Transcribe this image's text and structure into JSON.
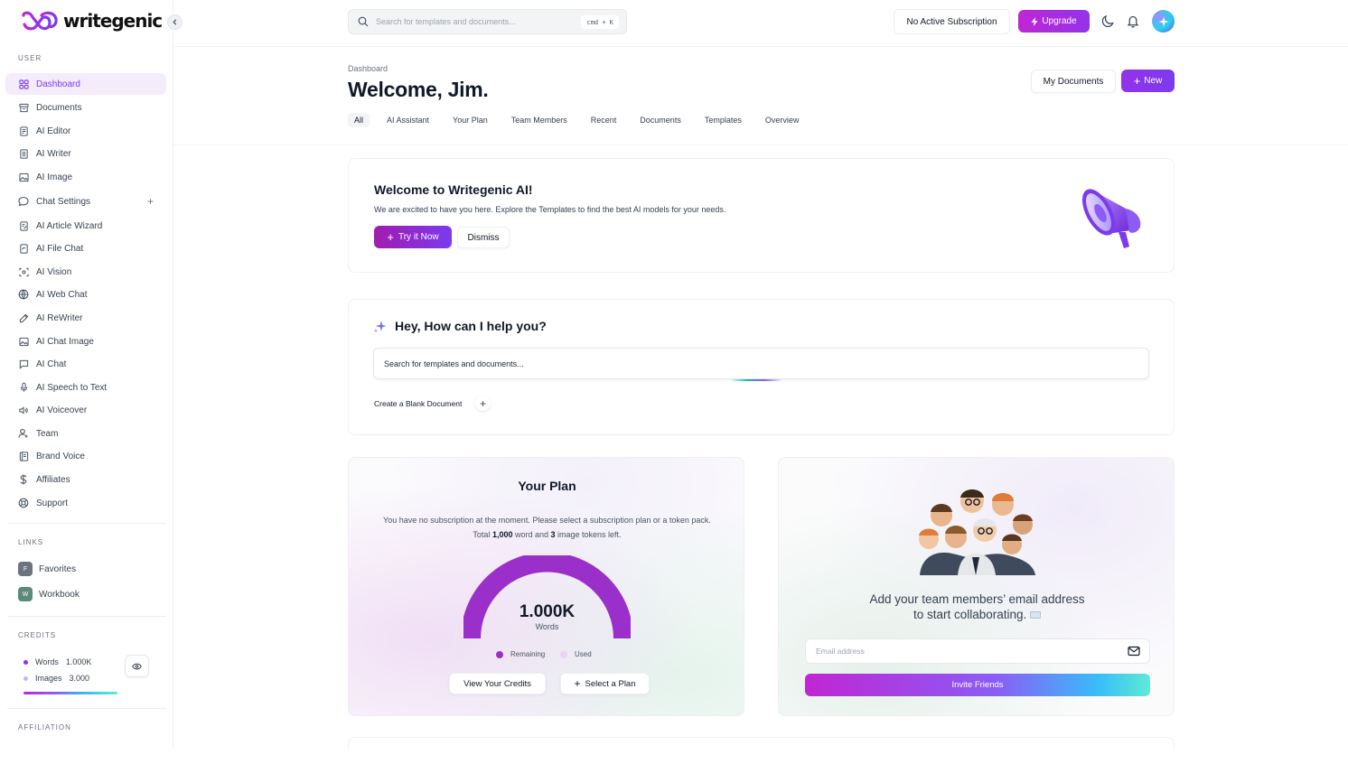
{
  "app": {
    "logo_text": "writegenic"
  },
  "sidebar": {
    "user_label": "USER",
    "items": [
      {
        "label": "Dashboard",
        "icon": "grid-icon"
      },
      {
        "label": "Documents",
        "icon": "archive-icon"
      },
      {
        "label": "AI Editor",
        "icon": "file-edit-icon"
      },
      {
        "label": "AI Writer",
        "icon": "file-text-icon"
      },
      {
        "label": "AI Image",
        "icon": "image-icon"
      },
      {
        "label": "Chat Settings",
        "icon": "chat-bubble-icon",
        "plus": "+"
      },
      {
        "label": "AI Article Wizard",
        "icon": "file-wand-icon"
      },
      {
        "label": "AI File Chat",
        "icon": "file-chat-icon"
      },
      {
        "label": "AI Vision",
        "icon": "scan-eye-icon"
      },
      {
        "label": "AI Web Chat",
        "icon": "globe-icon"
      },
      {
        "label": "AI ReWriter",
        "icon": "pen-icon"
      },
      {
        "label": "AI Chat Image",
        "icon": "image-chat-icon"
      },
      {
        "label": "AI Chat",
        "icon": "message-square-icon"
      },
      {
        "label": "AI Speech to Text",
        "icon": "microphone-icon"
      },
      {
        "label": "AI Voiceover",
        "icon": "speaker-icon"
      },
      {
        "label": "Team",
        "icon": "user-plus-icon"
      },
      {
        "label": "Brand Voice",
        "icon": "book-icon"
      },
      {
        "label": "Affiliates",
        "icon": "dollar-icon"
      },
      {
        "label": "Support",
        "icon": "lifebuoy-icon"
      }
    ],
    "links_label": "LINKS",
    "links": [
      {
        "badge": "F",
        "label": "Favorites",
        "color": "#6b7280"
      },
      {
        "badge": "W",
        "label": "Workbook",
        "color": "#5b8a7a"
      }
    ],
    "credits_label": "CREDITS",
    "credits": [
      {
        "label": "Words",
        "value": "1.000K",
        "color": "#9333ea"
      },
      {
        "label": "Images",
        "value": "3.000",
        "color": "#c4b5fd"
      }
    ],
    "affiliation_label": "AFFILIATION"
  },
  "header": {
    "search_placeholder": "Search for templates and documents...",
    "shortcut": "cmd + K",
    "subscription_label": "No Active Subscription",
    "upgrade_label": "Upgrade"
  },
  "page": {
    "breadcrumb": "Dashboard",
    "title": "Welcome, Jim.",
    "my_documents_label": "My Documents",
    "new_label": "New",
    "tabs": [
      "All",
      "AI Assistant",
      "Your Plan",
      "Team Members",
      "Recent",
      "Documents",
      "Templates",
      "Overview"
    ]
  },
  "welcome": {
    "title": "Welcome to Writegenic AI!",
    "text": "We are excited to have you here. Explore the Templates to find the best AI models for your needs.",
    "try_label": "Try it Now",
    "dismiss_label": "Dismiss"
  },
  "help": {
    "title": "Hey, How can I help you?",
    "input_placeholder": "Search for templates and documents...",
    "blank_doc_label": "Create a Blank Document"
  },
  "plan": {
    "title": "Your Plan",
    "text_prefix": "You have no subscription at the moment. Please select a subscription plan or a token pack. Total ",
    "words": "1,000",
    "text_mid": " word and ",
    "images": "3",
    "text_suffix": " image tokens left.",
    "gauge_value": "1.000K",
    "gauge_unit": "Words",
    "remaining_fraction": 1.0,
    "legend_remaining": "Remaining",
    "legend_used": "Used",
    "view_credits_label": "View Your Credits",
    "select_plan_label": "Select a Plan",
    "colors": {
      "remaining": "#9b2fc9",
      "used": "#e9d5f5"
    }
  },
  "team": {
    "title_line1": "Add your team members’ email address",
    "title_line2": "to start collaborating.",
    "email_placeholder": "Email address",
    "invite_label": "Invite Friends"
  }
}
